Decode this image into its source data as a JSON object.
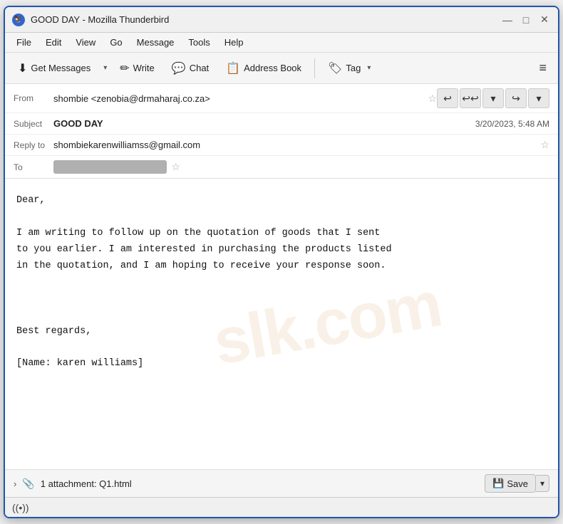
{
  "window": {
    "title": "GOOD DAY - Mozilla Thunderbird",
    "icon": "🔵"
  },
  "titlebar": {
    "title": "GOOD DAY - Mozilla Thunderbird",
    "minimize": "—",
    "maximize": "□",
    "close": "✕"
  },
  "menubar": {
    "items": [
      "File",
      "Edit",
      "View",
      "Go",
      "Message",
      "Tools",
      "Help"
    ]
  },
  "toolbar": {
    "get_messages": "Get Messages",
    "write": "Write",
    "chat": "Chat",
    "address_book": "Address Book",
    "tag": "Tag",
    "menu": "≡"
  },
  "email": {
    "from_label": "From",
    "from_value": "shombie <zenobia@drmaharaj.co.za>",
    "subject_label": "Subject",
    "subject_value": "GOOD DAY",
    "date_value": "3/20/2023, 5:48 AM",
    "reply_to_label": "Reply to",
    "reply_to_value": "shombiekarenwilliamss@gmail.com",
    "to_label": "To",
    "to_blurred": "████████████████",
    "body_line1": "Dear,",
    "body_line2": "",
    "body_line3": "I am writing to follow up on the quotation of goods that I sent",
    "body_line4": "to you earlier. I am interested in purchasing the products listed",
    "body_line5": "in the quotation, and I am hoping to receive your response soon.",
    "body_line6": "",
    "body_line7": "",
    "body_line8": "",
    "body_line9": "Best regards,",
    "body_line10": "",
    "body_line11": "[Name: karen williams]"
  },
  "attachment_bar": {
    "count": "1 attachment: Q1.html",
    "save_label": "Save"
  },
  "status_bar": {
    "wifi_icon": "📶"
  },
  "watermark": "slk.com"
}
